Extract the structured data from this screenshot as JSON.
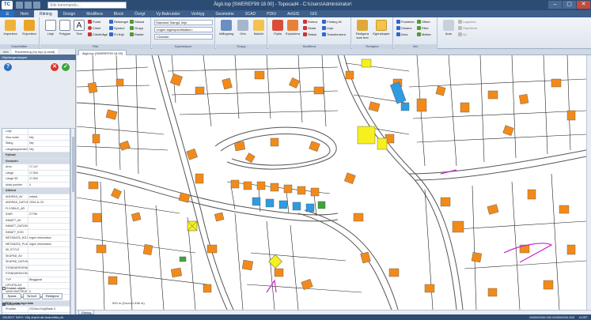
{
  "titlebar": {
    "command_placeholder": "Sök kommando...",
    "title": "Älgö.top [SWEREF99 18 00] - Topocad4 - C:\\Users\\Administrator\\",
    "minimize": "–",
    "maximize": "▢",
    "close": "✕"
  },
  "ribbon_tabs": [
    {
      "label": "Hem"
    },
    {
      "label": "Ritning"
    },
    {
      "label": "Design"
    },
    {
      "label": "Modifiera"
    },
    {
      "label": "Block"
    },
    {
      "label": "Övrigt"
    },
    {
      "label": "Vy-Bakrunder"
    },
    {
      "label": "Verktyg"
    },
    {
      "label": "Geometrie"
    },
    {
      "label": "3CAD"
    },
    {
      "label": "PDIU"
    },
    {
      "label": "ArtGIS"
    },
    {
      "label": "GIS"
    }
  ],
  "ribbon": {
    "import_label": "Importera",
    "export_label": "Exportera",
    "group_data": "Data/Nätter",
    "line_label": "Linje",
    "polygon_label": "Polygon",
    "text_label": "Text",
    "group_draw": "Rita",
    "small_col1": [
      "Punkt",
      "Cirkel",
      "Cirkelbåge"
    ],
    "small_col2": [
      "Rektangel",
      "Symbol",
      "Fri linje"
    ],
    "small_col3": [
      "Stickat",
      "Grupp",
      "Raster"
    ],
    "layer_combo": "Standard Stangd, linje",
    "layer_combo2": "<Ingen lagerspecifikation>",
    "layer_combo3": "<Globalt>",
    "group_layer": "Egenskaper",
    "snap_label": "Infångning",
    "ortho_label": "Orto",
    "cursor_label": "Markör",
    "group_snap": "Snapp",
    "move_label": "Flytta",
    "explode_label": "Explodera",
    "small_mod1": [
      "Rotera",
      "Skala",
      "Sträck"
    ],
    "small_mod2": [
      "Förläng till",
      "Linje",
      "Transformera"
    ],
    "group_modify": "Modifiera",
    "edit_objects_label": "Redigera som text",
    "properties_label": "Egenskaper",
    "group_edit": "Redigera",
    "small_point": [
      "Punktinfo",
      "Distans",
      "Area"
    ],
    "small_filter": [
      "Offset",
      "Filter",
      "Mellan"
    ],
    "group_info": "Info",
    "snap_on_label": "Auto",
    "small_right": [
      "Lagerinfo",
      "Objektinfo",
      "Vy"
    ]
  },
  "panel": {
    "tabs": [
      "Info",
      "Planeritning (Vy top) (Lokalt)"
    ],
    "header": "Objektegenskaper",
    "properties": [
      {
        "key": "Linje",
        "value": "",
        "cat": false
      },
      {
        "key": "Visa noder",
        "value": "Nej",
        "cat": false
      },
      {
        "key": "Stäng",
        "value": "Nej",
        "cat": false
      },
      {
        "key": "Längdsegmentering",
        "value": "Nej",
        "cat": false
      },
      {
        "key": "Fyllnad",
        "value": "",
        "cat": true
      },
      {
        "key": "Geometri",
        "value": "",
        "cat": true
      },
      {
        "key": "Area",
        "value": "17,147",
        "cat": false
      },
      {
        "key": "Längd",
        "value": "17,594",
        "cat": false
      },
      {
        "key": "Längd 3D",
        "value": "17,594",
        "cat": false
      },
      {
        "key": "Antal punkter",
        "value": "4",
        "cat": false
      },
      {
        "key": "Attribut",
        "value": "",
        "cat": true
      },
      {
        "key": "ANDRAD_AV",
        "value": "mdas1",
        "cat": false
      },
      {
        "key": "ANDRAD_DATUM",
        "value": "2004-11-23",
        "cat": false
      },
      {
        "key": "FLYGBILD_AR",
        "value": "",
        "cat": false
      },
      {
        "key": "IDNR",
        "value": "27756",
        "cat": false
      },
      {
        "key": "INMATT_AV",
        "value": "",
        "cat": false
      },
      {
        "key": "INMATT_DATUM",
        "value": "",
        "cat": false
      },
      {
        "key": "INMATT_KOD",
        "value": "",
        "cat": false
      },
      {
        "key": "METADATA_HOJD",
        "value": "Ingen information",
        "cat": false
      },
      {
        "key": "METADATA_PLAN",
        "value": "Ingen information",
        "cat": false
      },
      {
        "key": "MI_STYLE",
        "value": "",
        "cat": false
      },
      {
        "key": "SKAPAD_AV",
        "value": "",
        "cat": false
      },
      {
        "key": "SKAPAD_DATUM",
        "value": "",
        "cat": false
      },
      {
        "key": "STANDARDGRAD",
        "value": "",
        "cat": false
      },
      {
        "key": "STANDARDKODSAMT",
        "value": "",
        "cat": false
      },
      {
        "key": "TYP",
        "value": "Bbyggnad",
        "cat": false
      },
      {
        "key": "UPGIFSLAG",
        "value": "",
        "cat": false
      },
      {
        "key": "VAGKONSTRUKTION",
        "value": "0",
        "cat": false
      },
      {
        "key": "VAGUTFORANDE",
        "value": "Inventerat",
        "cat": false
      },
      {
        "key": "PDIU extra lagerdata",
        "value": "",
        "cat": true
      },
      {
        "key": "Provider",
        "value": "OGGeo.KingStade.3",
        "cat": false
      },
      {
        "key": "Förekomst",
        "value": "FB.Snö/30887A",
        "cat": false
      }
    ],
    "checkbox_lock": "Endast objekt",
    "btn_save": "Spara",
    "btn_remove": "Ta bort",
    "btn_edit": "Redigera",
    "checkbox_auto": "Autoprefix"
  },
  "map": {
    "tab_label": "Älgö.top (SWEREF99 18 00)",
    "sheet_tab": "Ritning",
    "scale_text": "500 m (Zoom 1:496 m)"
  },
  "status": {
    "left": "OBJEKT INFO: Välj objekt att ändra/titta på",
    "coord": "000000000.000 000000000.000",
    "mode": "KORT"
  },
  "colors": {
    "building": "#f28a1a",
    "building_blue": "#2f9be0",
    "building_yellow": "#f5f01e",
    "road": "#555555",
    "parcel": "#111111",
    "accent": "#3d5f8a"
  }
}
